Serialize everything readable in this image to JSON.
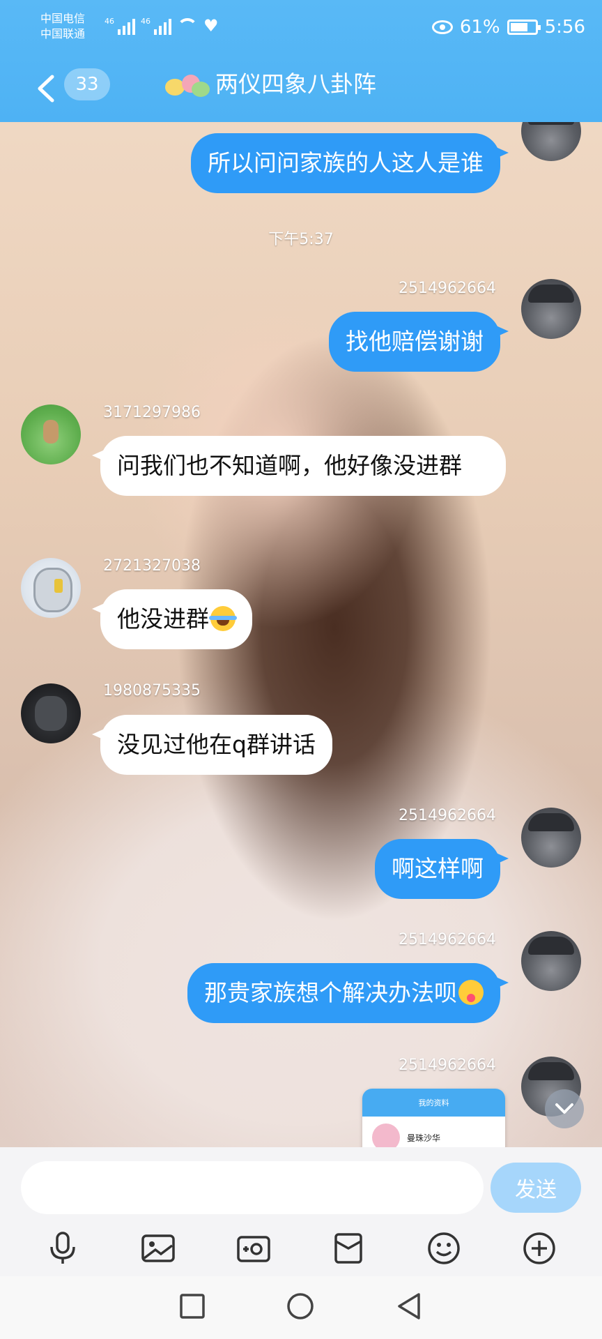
{
  "status_bar": {
    "carrier1": "中国电信",
    "carrier2": "中国联通",
    "network": "46",
    "battery": "61%",
    "time": "5:56"
  },
  "header": {
    "unread_count": "33",
    "title": "两仪四象八卦阵"
  },
  "messages": [
    {
      "id": "m0",
      "side": "out",
      "text": "所以问问家族的人这人是谁"
    },
    {
      "id": "t1",
      "type": "time",
      "text": "下午5:37"
    },
    {
      "id": "m1",
      "side": "out",
      "uid": "2514962664",
      "text": "找他赔偿谢谢"
    },
    {
      "id": "m2",
      "side": "in",
      "uid": "3171297986",
      "text": "问我们也不知道啊，他好像没进群"
    },
    {
      "id": "m3",
      "side": "in",
      "uid": "2721327038",
      "text": "他没进群"
    },
    {
      "id": "m4",
      "side": "in",
      "uid": "1980875335",
      "text": "没见过他在q群讲话"
    },
    {
      "id": "m5",
      "side": "out",
      "uid": "2514962664",
      "text": "啊这样啊"
    },
    {
      "id": "m6",
      "side": "out",
      "uid": "2514962664",
      "text": "那贵家族想个解决办法呗"
    },
    {
      "id": "m7",
      "side": "out",
      "uid": "2514962664"
    }
  ],
  "thumbnail": {
    "header": "我的资料",
    "name": "曼珠沙华"
  },
  "composer": {
    "placeholder": "",
    "send_label": "发送"
  },
  "icons": {
    "back": "chevron-left-icon",
    "voice": "microphone-icon",
    "image": "image-icon",
    "camera": "camera-icon",
    "box": "box-icon",
    "emoji": "emoji-icon",
    "plus": "plus-icon",
    "scroll": "chevron-down-icon"
  }
}
